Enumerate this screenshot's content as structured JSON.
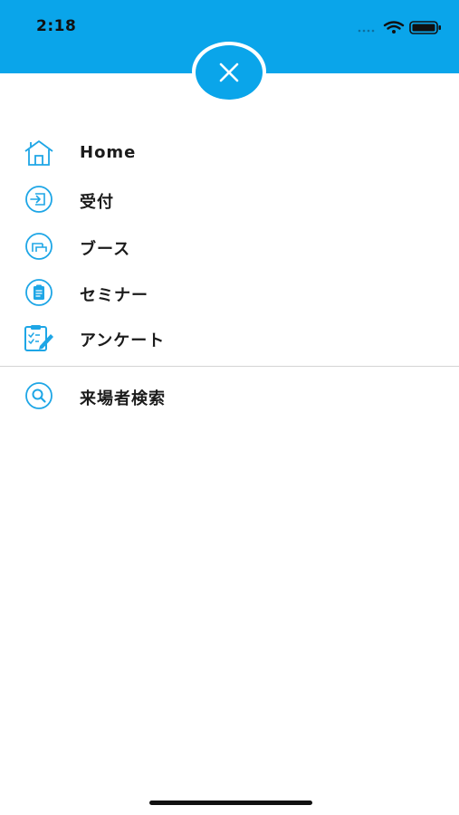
{
  "status_bar": {
    "time": "2:18",
    "background_color": "#0aa5ea",
    "icons": [
      "signal-icon",
      "wifi-icon",
      "battery-icon"
    ]
  },
  "close_button": {
    "icon": "close-icon",
    "color": "#0aa5ea"
  },
  "menu": {
    "items": [
      {
        "label": "Home",
        "icon": "home-icon"
      },
      {
        "label": "受付",
        "icon": "reception-icon"
      },
      {
        "label": "ブース",
        "icon": "booth-icon"
      },
      {
        "label": "セミナー",
        "icon": "seminar-icon"
      },
      {
        "label": "アンケート",
        "icon": "survey-icon"
      },
      {
        "label": "来場者検索",
        "icon": "search-icon"
      }
    ]
  },
  "accent_color": "#1ea6e6"
}
